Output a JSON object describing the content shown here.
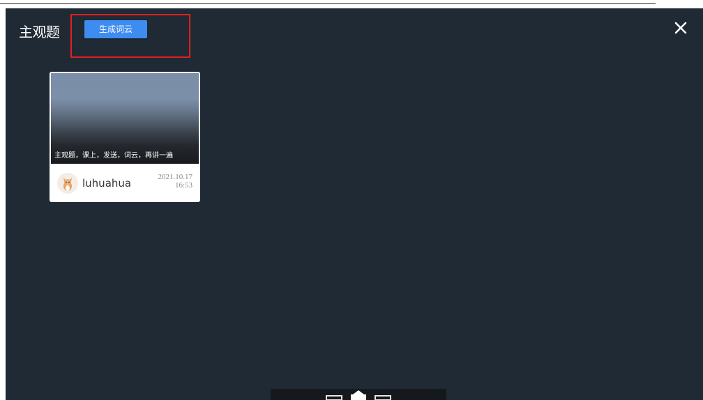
{
  "header": {
    "title": "主观题",
    "generate_button_label": "生成词云",
    "close_icon": "close-icon"
  },
  "cards": [
    {
      "caption": "主观题，课上，发送，词云，再讲一遍",
      "username": "luhuahua",
      "date": "2021.10.17",
      "time": "16:53"
    }
  ],
  "colors": {
    "panel_bg": "#1f2a35",
    "button_bg": "#3f8cf0",
    "annotation_border": "#e02020"
  }
}
